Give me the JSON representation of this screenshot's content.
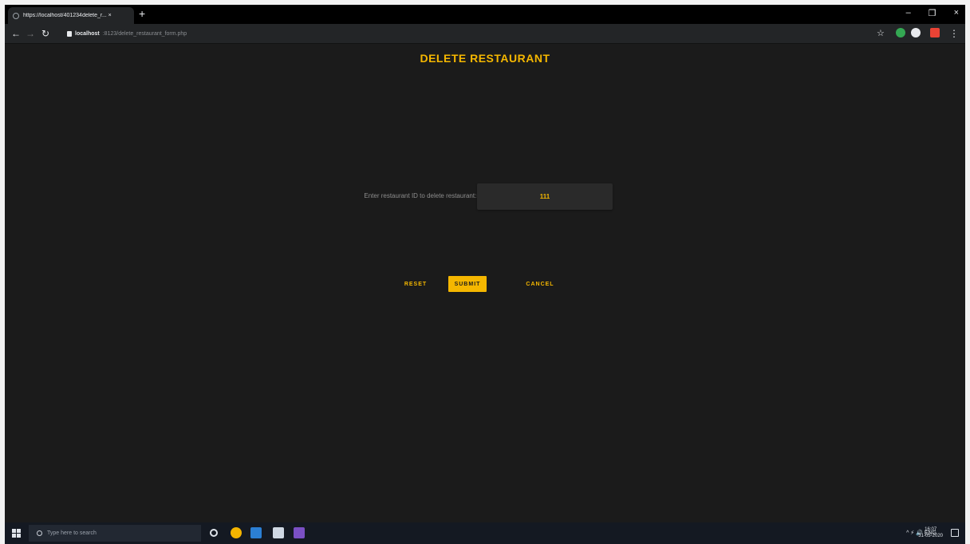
{
  "browser": {
    "tab_title": "https://localhost/401234delete_r... ×",
    "tab_close": "×",
    "new_tab": "+",
    "win_min": "–",
    "win_max": "❐",
    "win_close": "×",
    "host": "localhost",
    "path": ":8123/delete_restaurant_form.php",
    "back": "←",
    "forward": "→",
    "reload": "↻",
    "star": "☆",
    "menu": "⋮"
  },
  "page": {
    "title": "DELETE RESTAURANT",
    "id_label": "Enter restaurant ID to delete restaurant:-",
    "id_value": "111",
    "reset_label": "RESET",
    "submit_label": "SUBMIT",
    "cancel_label": "CANCEL"
  },
  "taskbar": {
    "search_placeholder": "Type here to search",
    "tray_text": "^  ⚡  🔊  ENG",
    "time": "16:07",
    "date": "31-05-2020"
  },
  "colors": {
    "accent": "#f5b700",
    "background": "#1b1b1b",
    "input_bg": "#2a2a2a"
  },
  "icons": [
    "back-icon",
    "forward-icon",
    "reload-icon",
    "lock-icon",
    "star-icon",
    "menu-icon",
    "windows-start-icon",
    "search-icon",
    "task-view-icon",
    "chrome-icon",
    "mail-icon",
    "photos-icon",
    "visual-studio-icon",
    "notification-icon"
  ]
}
